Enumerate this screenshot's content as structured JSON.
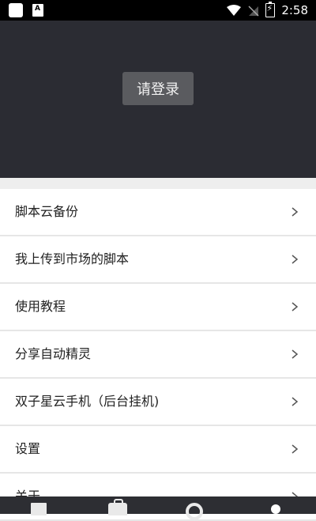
{
  "status_bar": {
    "time": "2:58",
    "icons": [
      "app-icon",
      "notification-icon",
      "wifi-icon",
      "signal-icon",
      "battery-icon"
    ]
  },
  "header": {
    "login_label": "请登录",
    "background_color": "#2b2c33"
  },
  "menu": {
    "items": [
      {
        "label": "脚本云备份"
      },
      {
        "label": "我上传到市场的脚本"
      },
      {
        "label": "使用教程"
      },
      {
        "label": "分享自动精灵"
      },
      {
        "label": "双子星云手机（后台挂机)"
      },
      {
        "label": "设置"
      },
      {
        "label": "关于"
      }
    ]
  },
  "bottom_nav": {
    "icons": [
      "document-icon",
      "briefcase-icon",
      "target-icon",
      "profile-dot-icon"
    ]
  }
}
